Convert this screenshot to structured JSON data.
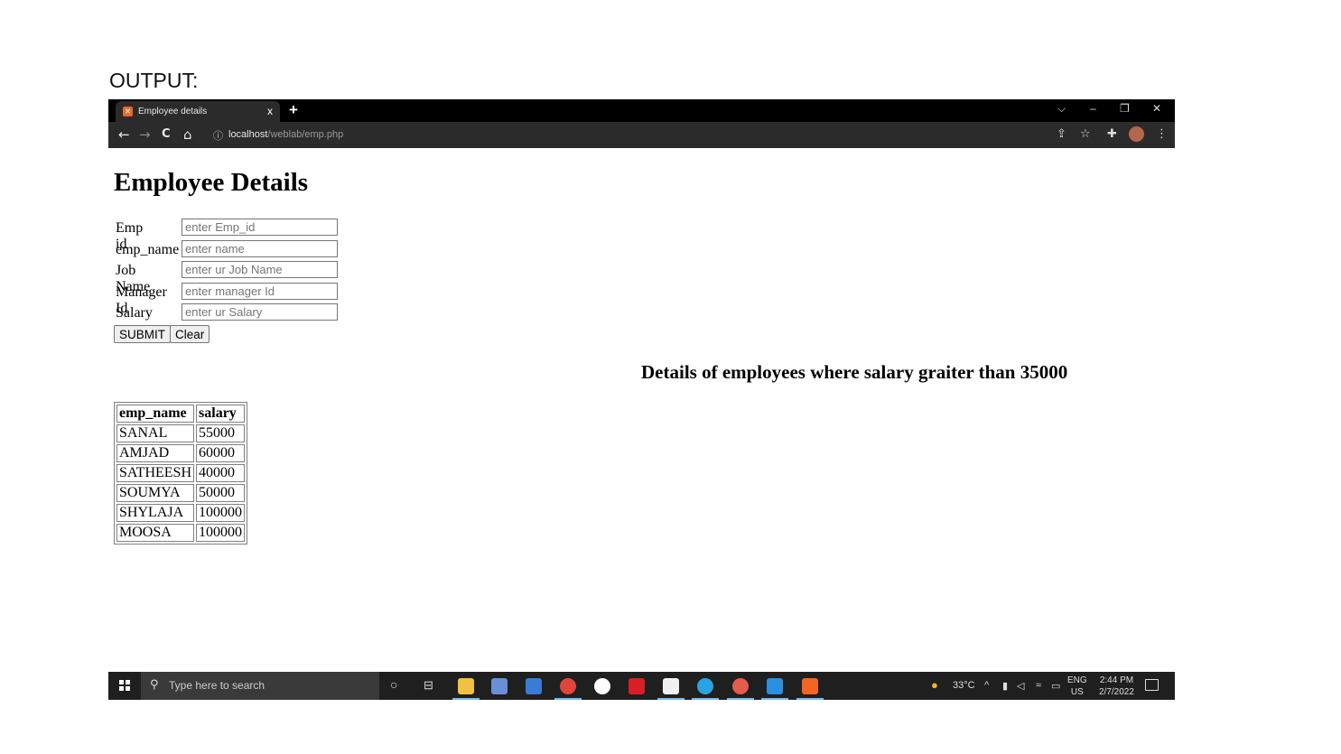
{
  "caption": "OUTPUT:",
  "browser": {
    "tab_title": "Employee details",
    "tab_close": "x",
    "new_tab": "+",
    "url_host": "localhost",
    "url_path": "/weblab/emp.php",
    "window_controls": [
      "⌵",
      "–",
      "❐",
      "✕"
    ],
    "nav_icons": [
      "←",
      "→",
      "C",
      "⌂"
    ]
  },
  "page": {
    "title": "Employee Details",
    "form": {
      "fields": [
        {
          "label": "Emp id",
          "placeholder": "enter Emp_id"
        },
        {
          "label": "emp_name",
          "placeholder": "enter name"
        },
        {
          "label": "Job Name",
          "placeholder": "enter ur Job Name"
        },
        {
          "label": "Manager Id",
          "placeholder": "enter manager Id"
        },
        {
          "label": "Salary",
          "placeholder": "enter ur Salary"
        }
      ],
      "submit_label": "SUBMIT",
      "clear_label": "Clear"
    },
    "side_heading": "Details of employees where salary graiter than 35000",
    "table": {
      "headers": [
        "emp_name",
        "salary"
      ],
      "rows": [
        [
          "SANAL",
          "55000"
        ],
        [
          "AMJAD",
          "60000"
        ],
        [
          "SATHEESH",
          "40000"
        ],
        [
          "SOUMYA",
          "50000"
        ],
        [
          "SHYLAJA",
          "100000"
        ],
        [
          "MOOSA",
          "100000"
        ]
      ]
    }
  },
  "taskbar": {
    "search_placeholder": "Type here to search",
    "weather": "33°C",
    "lang_top": "ENG",
    "lang_bottom": "US",
    "time": "2:44 PM",
    "date": "2/7/2022",
    "app_colors": [
      "#f0c040",
      "#6a8fd6",
      "#3a7bd5",
      "#e0453a",
      "#ffffff",
      "#d81f26",
      "#f0f0f0",
      "#2aa3e0",
      "#e55b4d",
      "#2b8fe0",
      "#f26522"
    ]
  }
}
